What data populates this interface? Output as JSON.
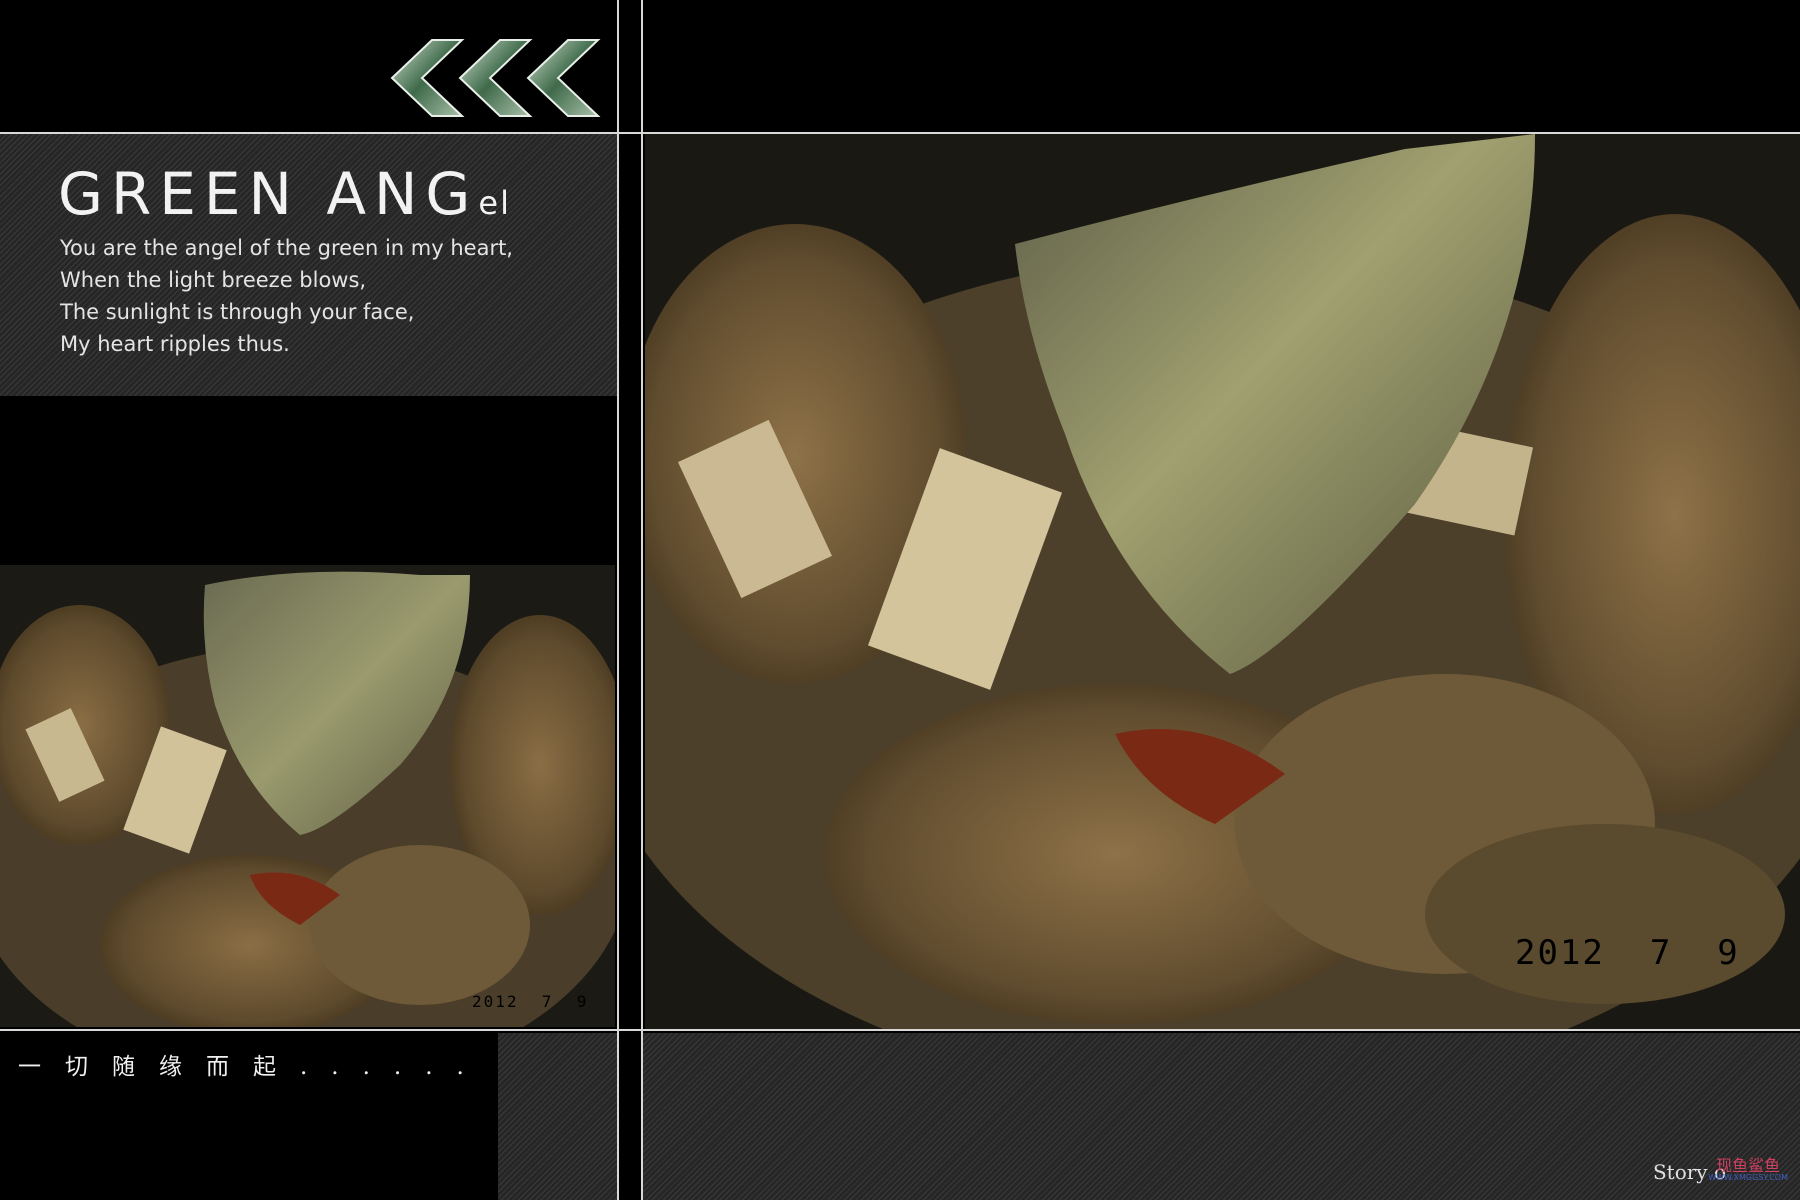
{
  "header": {
    "chevron_count": 3,
    "chevron_icon": "double-chevron-left-icon"
  },
  "title": {
    "main": "GREEN ANG",
    "suffix": "el"
  },
  "poem": [
    "You are the angel of the green in my heart,",
    "When the light breeze blows,",
    "The sunlight is through your face,",
    "My heart ripples thus."
  ],
  "photos": {
    "small_date_stamp": "2012  7  9",
    "large_date_stamp": "2012  7  9"
  },
  "footer": {
    "chinese_text": "一切随缘而起......",
    "story_text": "Story o",
    "watermark_text": "现鱼鲨鱼",
    "watermark_url": "WWW.XMGGSY.COM"
  },
  "colors": {
    "background": "#000000",
    "frame_line": "#d8d8d8",
    "hatch_panel": "#2a2a2a",
    "date_stamp": "#e0302a"
  }
}
